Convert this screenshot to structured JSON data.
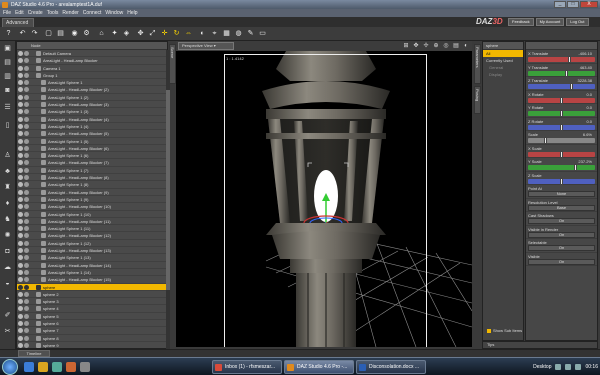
{
  "window": {
    "title": "DAZ Studio 4.6 Pro - arealamptest1A.duf",
    "controls": [
      "_",
      "□",
      "X"
    ]
  },
  "menu": [
    "File",
    "Edit",
    "Create",
    "Tools",
    "Render",
    "Connect",
    "Window",
    "Help"
  ],
  "top": {
    "tab": "Advanced",
    "logo_text": "DAZ",
    "logo_accent": "3D",
    "buttons": [
      "Feedback",
      "My Account",
      "Log Out"
    ]
  },
  "scene": {
    "header": "Node",
    "rows": [
      {
        "label": "Default Camera",
        "indent": 1
      },
      {
        "label": "AreaLight - HeadLamp Blocker",
        "indent": 1
      },
      {
        "label": "Camera 1",
        "indent": 1
      },
      {
        "label": "Group 1",
        "indent": 1
      },
      {
        "label": "AreaLight Sphere 1",
        "indent": 2
      },
      {
        "label": "AreaLight - HeadLamp Blocker (2)",
        "indent": 2
      },
      {
        "label": "AreaLight Sphere 1 (2)",
        "indent": 2
      },
      {
        "label": "AreaLight - HeadLamp Blocker (3)",
        "indent": 2
      },
      {
        "label": "AreaLight Sphere 1 (3)",
        "indent": 2
      },
      {
        "label": "AreaLight - HeadLamp Blocker (4)",
        "indent": 2
      },
      {
        "label": "AreaLight Sphere 1 (4)",
        "indent": 2
      },
      {
        "label": "AreaLight - HeadLamp Blocker (5)",
        "indent": 2
      },
      {
        "label": "AreaLight Sphere 1 (5)",
        "indent": 2
      },
      {
        "label": "AreaLight - HeadLamp Blocker (6)",
        "indent": 2
      },
      {
        "label": "AreaLight Sphere 1 (6)",
        "indent": 2
      },
      {
        "label": "AreaLight - HeadLamp Blocker (7)",
        "indent": 2
      },
      {
        "label": "AreaLight Sphere 1 (7)",
        "indent": 2
      },
      {
        "label": "AreaLight - HeadLamp Blocker (8)",
        "indent": 2
      },
      {
        "label": "AreaLight Sphere 1 (8)",
        "indent": 2
      },
      {
        "label": "AreaLight - HeadLamp Blocker (9)",
        "indent": 2
      },
      {
        "label": "AreaLight Sphere 1 (9)",
        "indent": 2
      },
      {
        "label": "AreaLight - HeadLamp Blocker (10)",
        "indent": 2
      },
      {
        "label": "AreaLight Sphere 1 (10)",
        "indent": 2
      },
      {
        "label": "AreaLight - HeadLamp Blocker (11)",
        "indent": 2
      },
      {
        "label": "AreaLight Sphere 1 (11)",
        "indent": 2
      },
      {
        "label": "AreaLight - HeadLamp Blocker (12)",
        "indent": 2
      },
      {
        "label": "AreaLight Sphere 1 (12)",
        "indent": 2
      },
      {
        "label": "AreaLight - HeadLamp Blocker (13)",
        "indent": 2
      },
      {
        "label": "AreaLight Sphere 1 (13)",
        "indent": 2
      },
      {
        "label": "AreaLight - HeadLamp Blocker (14)",
        "indent": 2
      },
      {
        "label": "AreaLight Sphere 1 (14)",
        "indent": 2
      },
      {
        "label": "AreaLight - HeadLamp Blocker (15)",
        "indent": 2
      },
      {
        "label": "sphere",
        "indent": 1,
        "selected": true
      },
      {
        "label": "sphere 2",
        "indent": 1
      },
      {
        "label": "sphere 3",
        "indent": 1
      },
      {
        "label": "sphere 4",
        "indent": 1
      },
      {
        "label": "sphere 5",
        "indent": 1
      },
      {
        "label": "sphere 6",
        "indent": 1
      },
      {
        "label": "sphere 7",
        "indent": 1
      },
      {
        "label": "sphere 8",
        "indent": 1
      },
      {
        "label": "sphere 9",
        "indent": 1
      }
    ]
  },
  "left_tabs": [
    "Scene"
  ],
  "viewport": {
    "view_label": "Perspective View",
    "coord": "1 : 1.4142"
  },
  "right_tabs": [
    "Parameters",
    "Posing"
  ],
  "nodelist": {
    "header": "sphere",
    "items": [
      {
        "label": "All",
        "selected": true
      },
      {
        "label": "Currently Used",
        "dim": false
      },
      {
        "label": "General",
        "dim": true
      },
      {
        "label": "Display",
        "dim": true
      }
    ],
    "show_sub_items": "Show Sub Items"
  },
  "params": [
    {
      "type": "slider",
      "label": "X Translate",
      "value": "-406.10",
      "color": "#b84444",
      "knob": 0.62
    },
    {
      "type": "slider",
      "label": "Y Translate",
      "value": "463.40",
      "color": "#3aa03a",
      "knob": 0.58
    },
    {
      "type": "slider",
      "label": "Z Translate",
      "value": "3228.38",
      "color": "#4f60c0",
      "knob": 0.66
    },
    {
      "type": "slider",
      "label": "X Rotate",
      "value": "0.0",
      "color": "#b84444",
      "knob": 0.5
    },
    {
      "type": "slider",
      "label": "Y Rotate",
      "value": "0.0",
      "color": "#3aa03a",
      "knob": 0.5
    },
    {
      "type": "slider",
      "label": "Z Rotate",
      "value": "0.0",
      "color": "#4f60c0",
      "knob": 0.5
    },
    {
      "type": "slider",
      "label": "Scale",
      "value": "6.6%",
      "color": "#888888",
      "knob": 0.25
    },
    {
      "type": "slider",
      "label": "X Scale",
      "value": "",
      "color": "#b84444",
      "knob": 0.5
    },
    {
      "type": "slider",
      "label": "Y Scale",
      "value": "237.2%",
      "color": "#3aa03a",
      "knob": 0.72
    },
    {
      "type": "slider",
      "label": "Z Scale",
      "value": "",
      "color": "#4f60c0",
      "knob": 0.5
    },
    {
      "type": "button",
      "label": "Point At",
      "value": "None"
    },
    {
      "type": "button",
      "label": "Resolution Level",
      "value": "Base"
    },
    {
      "type": "button",
      "label": "Cast Shadows",
      "value": "On"
    },
    {
      "type": "button",
      "label": "Visible in Render",
      "value": "On"
    },
    {
      "type": "button",
      "label": "Selectable",
      "value": "On"
    },
    {
      "type": "button",
      "label": "Visible",
      "value": "On"
    }
  ],
  "bottom": {
    "timeline_tab": "Timeline",
    "tips": "Tips"
  },
  "taskbar": {
    "items": [
      {
        "label": "Inbox (1) - rfsmeszar...",
        "color": "#d84a3a",
        "active": false
      },
      {
        "label": "DAZ Studio 4.6 Pro -...",
        "color": "#e08a1c",
        "active": true
      },
      {
        "label": "Disconsolation.docx ...",
        "color": "#2b5fb4",
        "active": false
      }
    ],
    "desktop": "Desktop",
    "time": "00:16"
  }
}
